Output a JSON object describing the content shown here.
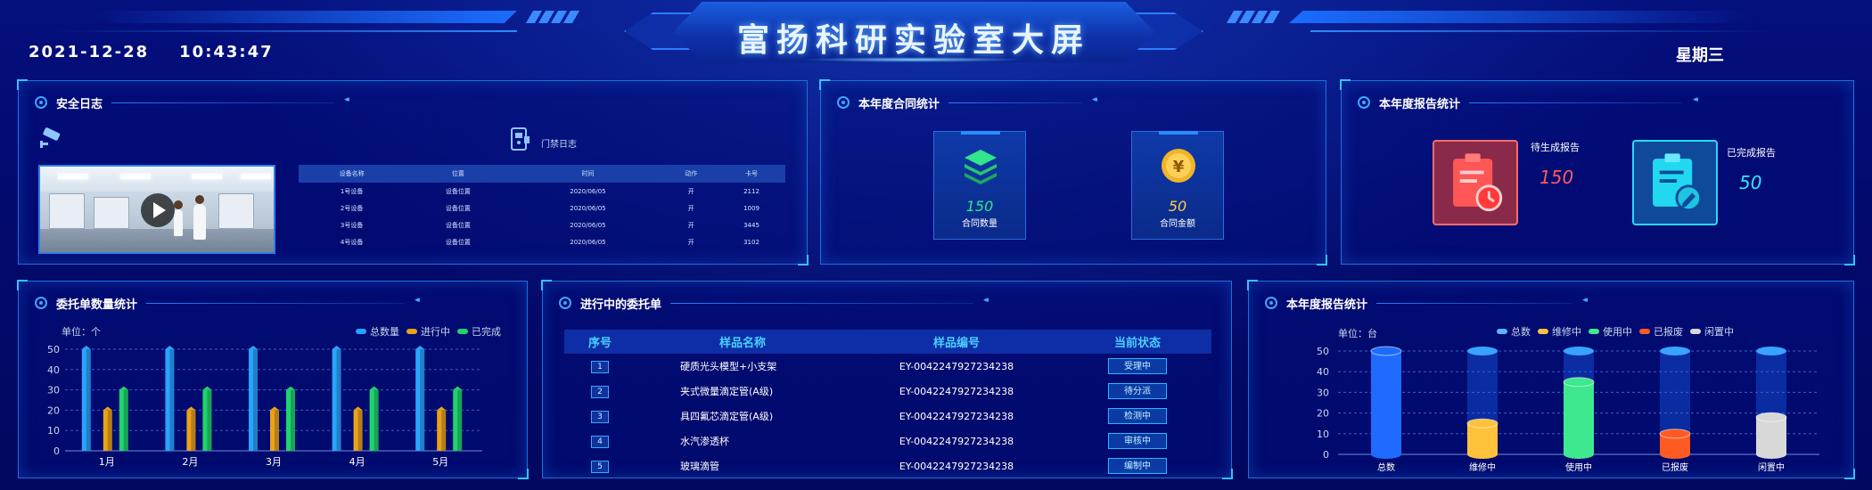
{
  "header": {
    "title": "富扬科研实验室大屏",
    "date": "2021-12-28",
    "time": "10:43:47",
    "weekday": "星期三"
  },
  "security_log": {
    "title": "安全日志",
    "door_log_label": "门禁日志",
    "columns": [
      "设备名称",
      "位置",
      "时间",
      "动作",
      "卡号"
    ],
    "rows": [
      [
        "1号设备",
        "设备位置",
        "2020/06/05",
        "开",
        "2112"
      ],
      [
        "2号设备",
        "设备位置",
        "2020/06/05",
        "开",
        "1009"
      ],
      [
        "3号设备",
        "设备位置",
        "2020/06/05",
        "开",
        "3445"
      ],
      [
        "4号设备",
        "设备位置",
        "2020/06/05",
        "开",
        "3102"
      ]
    ]
  },
  "contract_stats": {
    "title": "本年度合同统计",
    "items": [
      {
        "value": "150",
        "label": "合同数量",
        "icon": "layers-icon",
        "color": "#33e58a"
      },
      {
        "value": "50",
        "label": "合同金额",
        "icon": "yen-coin-icon",
        "color": "#ffcf3a"
      }
    ]
  },
  "report_stats_top": {
    "title": "本年度报告统计",
    "items": [
      {
        "label": "待生成报告",
        "value": "150",
        "color": "#ff5a5a",
        "icon": "clipboard-clock-icon"
      },
      {
        "label": "已完成报告",
        "value": "50",
        "color": "#33e6ff",
        "icon": "clipboard-edit-icon"
      }
    ]
  },
  "order_count_chart": {
    "title": "委托单数量统计",
    "unit": "单位：个",
    "legend": [
      "总数量",
      "进行中",
      "已完成"
    ],
    "colors": [
      "#2aa3ff",
      "#e9a21a",
      "#21d36e"
    ]
  },
  "orders": {
    "title": "进行中的委托单",
    "columns": [
      "序号",
      "样品名称",
      "样品编号",
      "当前状态"
    ],
    "rows": [
      {
        "idx": "1",
        "name": "硬质光头模型+小支架",
        "code": "EY-0042247927234238",
        "status": "受理中"
      },
      {
        "idx": "2",
        "name": "夹式微量滴定管(A级)",
        "code": "EY-0042247927234238",
        "status": "待分派"
      },
      {
        "idx": "3",
        "name": "具四氟芯滴定管(A级)",
        "code": "EY-0042247927234238",
        "status": "检测中"
      },
      {
        "idx": "4",
        "name": "水汽渗透杯",
        "code": "EY-0042247927234238",
        "status": "审核中"
      },
      {
        "idx": "5",
        "name": "玻璃滴管",
        "code": "EY-0042247927234238",
        "status": "编制中"
      }
    ]
  },
  "report_stats_chart": {
    "title": "本年度报告统计",
    "unit": "单位：台",
    "legend": [
      "总数",
      "维修中",
      "使用中",
      "已报废",
      "闲置中"
    ],
    "colors": [
      "#1f6bff",
      "#ffc23a",
      "#3ee88e",
      "#ff5a22",
      "#d8d8d8"
    ]
  },
  "chart_data": [
    {
      "type": "bar",
      "categories": [
        "1月",
        "2月",
        "3月",
        "4月",
        "5月"
      ],
      "series": [
        {
          "name": "总数量",
          "values": [
            50,
            50,
            50,
            50,
            50
          ]
        },
        {
          "name": "进行中",
          "values": [
            20,
            20,
            20,
            20,
            20
          ]
        },
        {
          "name": "已完成",
          "values": [
            30,
            30,
            30,
            30,
            30
          ]
        }
      ],
      "ylim": [
        0,
        50
      ],
      "yticks": [
        0,
        10,
        20,
        30,
        40,
        50
      ],
      "grid": true,
      "legend_position": "top-right"
    },
    {
      "type": "bar",
      "categories": [
        "总数",
        "维修中",
        "使用中",
        "已报废",
        "闲置中"
      ],
      "values": [
        50,
        15,
        35,
        10,
        18
      ],
      "ylim": [
        0,
        50
      ],
      "yticks": [
        0,
        10,
        20,
        30,
        40,
        50
      ],
      "grid": true,
      "legend_position": "top-right"
    }
  ]
}
